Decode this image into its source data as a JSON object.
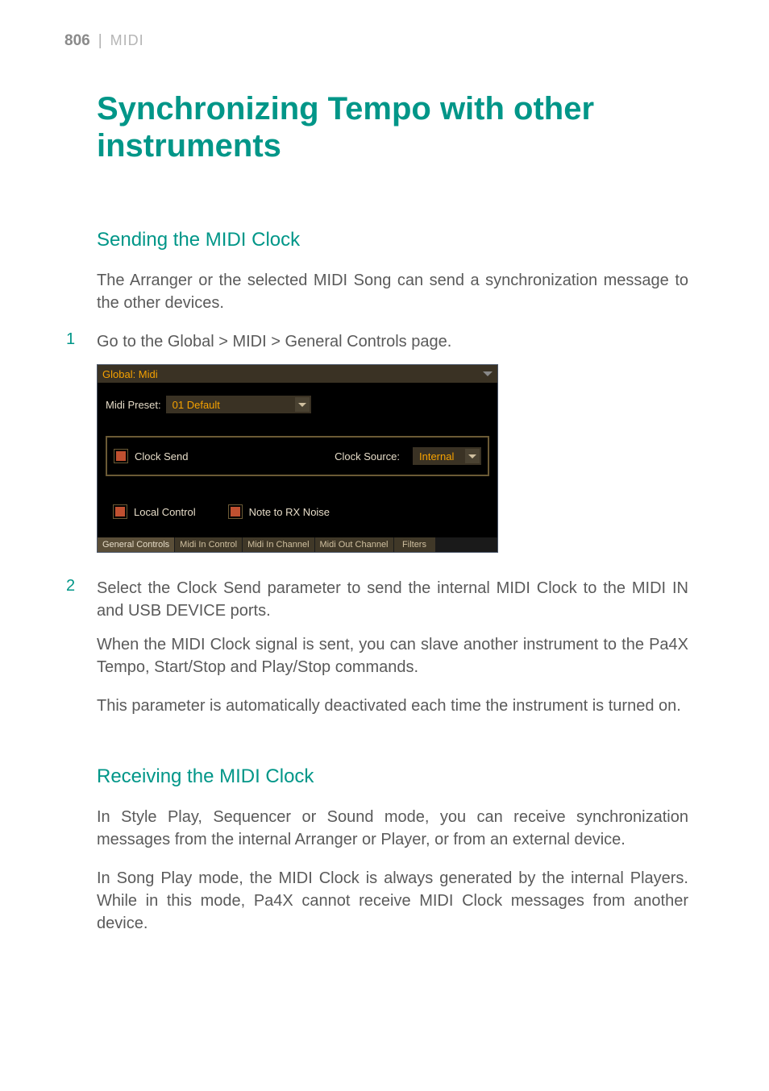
{
  "header": {
    "page_number": "806",
    "divider": "|",
    "section": "MIDI"
  },
  "title": "Synchronizing Tempo with other instruments",
  "section1": {
    "heading": "Sending the MIDI Clock",
    "intro": "The Arranger or the selected MIDI Song can send a synchronization message to the other devices.",
    "step1": {
      "num": "1",
      "pre": "Go to the ",
      "gray": "Global > MIDI > General Controls",
      "post": " page."
    },
    "step2": {
      "num": "2",
      "pre": "Select the ",
      "g1": "Clock Send",
      "mid1": " parameter to send the internal MIDI Clock to the ",
      "g2": "MIDI IN",
      "mid2": " and ",
      "g3": "USB DEVICE",
      "post": " ports."
    },
    "para2": "When the MIDI Clock signal is sent, you can slave another instrument to the Pa4X Tempo, Start/Stop and Play/Stop commands.",
    "para3": "This parameter is automatically deactivated each time the instrument is turned on."
  },
  "ui": {
    "title": "Global: Midi",
    "preset_label": "Midi Preset:",
    "preset_value": "01 Default",
    "clock_send_label": "Clock Send",
    "clock_source_label": "Clock Source:",
    "clock_source_value": "Internal",
    "local_control_label": "Local Control",
    "note_rx_label": "Note to RX Noise",
    "tabs": [
      "General Controls",
      "Midi In Control",
      "Midi In Channel",
      "Midi Out Channel",
      "Filters"
    ]
  },
  "section2": {
    "heading": "Receiving the MIDI Clock",
    "para1": "In Style Play, Sequencer or Sound mode, you can receive synchronization messages from the internal Arranger or Player, or from an external device.",
    "para2": "In Song Play mode, the MIDI Clock is always generated by the internal Players. While in this mode, Pa4X cannot receive MIDI Clock messages from another device."
  }
}
